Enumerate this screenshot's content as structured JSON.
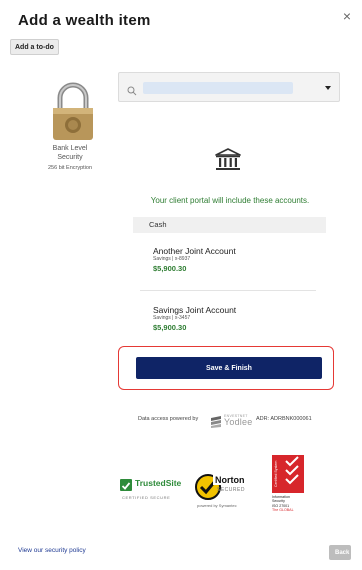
{
  "header": {
    "title": "Add a wealth item",
    "close_glyph": "×"
  },
  "toolbar": {
    "todo_label": "Add a to-do"
  },
  "security": {
    "icon": "lock-icon",
    "label_line1": "Bank Level",
    "label_line2": "Security",
    "encryption": "256 bit Encryption"
  },
  "search": {
    "value": "",
    "icon": "search-icon"
  },
  "accounts_panel": {
    "institution_icon": "bank-icon",
    "portal_message": "Your client portal will include these accounts.",
    "group_label": "Cash",
    "accounts": [
      {
        "name": "Another Joint Account",
        "sub": "Savings | x-8937",
        "amount": "$5,900.30"
      },
      {
        "name": "Savings Joint Account",
        "sub": "Savings | x-3457",
        "amount": "$5,900.30"
      }
    ]
  },
  "actions": {
    "save_label": "Save & Finish",
    "back_label": "Back"
  },
  "footer": {
    "powered_by": "Data access powered by",
    "yodlee_small": "ENVESTNET",
    "yodlee_name": "Yodlee",
    "adr": "ADR: ADRBNK000061",
    "trusted_name": "TrustedSite",
    "trusted_sub": "CERTIFIED SECURE",
    "norton_name": "Norton",
    "norton_secured": "SECURED",
    "norton_by": "powered by Symantec",
    "iso_vertical": "Certified System",
    "iso_text": [
      "Information",
      "Security",
      "ISO 27001",
      "The GLOBAL"
    ],
    "policy_link": "View our security policy"
  },
  "colors": {
    "accent_navy": "#0f2466",
    "success_green": "#2e7d32",
    "highlight_red": "#e53935"
  }
}
